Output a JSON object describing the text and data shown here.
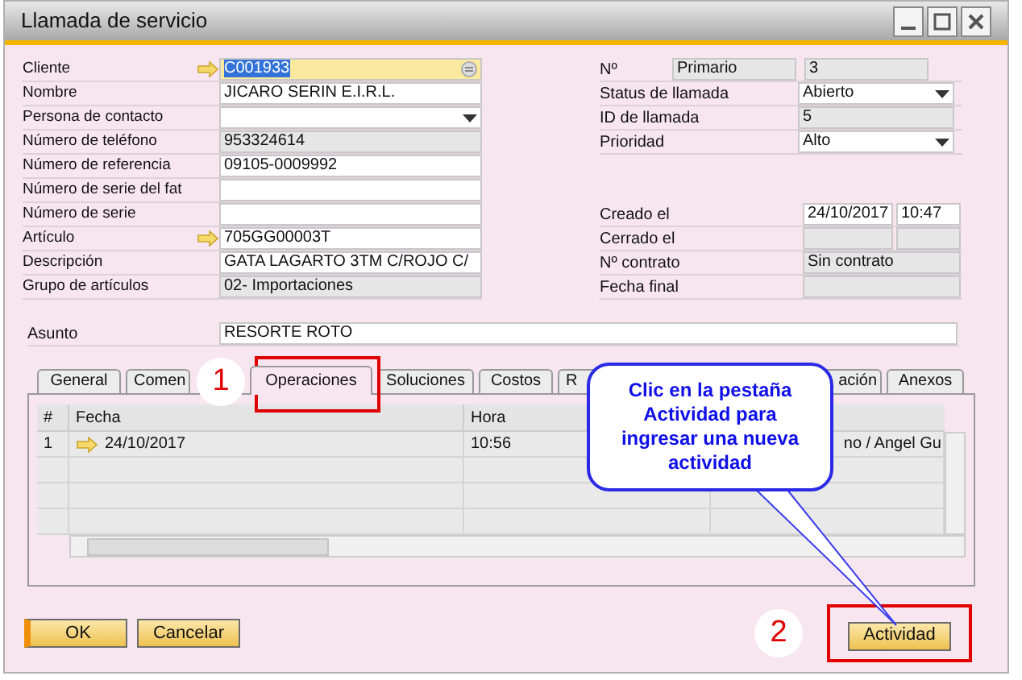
{
  "window": {
    "title": "Llamada de servicio"
  },
  "left_fields": [
    {
      "label": "Cliente",
      "kind": "lookup",
      "value": "C001933",
      "focused": true
    },
    {
      "label": "Nombre",
      "kind": "text",
      "value": "JICARO SERIN E.I.R.L.",
      "focused": false
    },
    {
      "label": "Persona de contacto",
      "kind": "dropdown",
      "focused": false
    },
    {
      "label": "Número de teléfono",
      "kind": "readonly",
      "value": "953324614",
      "focused": false
    },
    {
      "label": "Número de referencia",
      "kind": "text",
      "value": "09105-0009992",
      "focused": false
    },
    {
      "label": "Número de serie del fat",
      "kind": "text",
      "focused": false
    },
    {
      "label": "Número de serie",
      "kind": "text",
      "focused": false
    },
    {
      "label": "Artículo",
      "kind": "lookup",
      "value": "705GG00003T",
      "focused": false
    },
    {
      "label": "Descripción",
      "kind": "text",
      "value": "GATA LAGARTO 3TM C/ROJO  C/",
      "focused": false
    },
    {
      "label": "Grupo de artículos",
      "kind": "readonly",
      "value": "02- Importaciones",
      "focused": false
    }
  ],
  "right_fields_top": [
    {
      "label": "Nº",
      "fields": [
        {
          "kind": "readonly",
          "value": "Primario"
        },
        {
          "kind": "readonly",
          "value": "3"
        }
      ]
    },
    {
      "label": "Status de llamada",
      "fields": [
        {
          "kind": "dropdown",
          "value": "Abierto"
        }
      ]
    },
    {
      "label": "ID de llamada",
      "fields": [
        {
          "kind": "readonly",
          "value": "5"
        }
      ]
    },
    {
      "label": "Prioridad",
      "fields": [
        {
          "kind": "dropdown",
          "value": "Alto"
        }
      ]
    }
  ],
  "right_fields_bottom": [
    {
      "label": "Creado el",
      "fields": [
        {
          "kind": "text",
          "value": "24/10/2017"
        },
        {
          "kind": "text",
          "value": "10:47"
        }
      ]
    },
    {
      "label": "Cerrado el",
      "fields": [
        {
          "kind": "readonly"
        },
        {
          "kind": "readonly"
        }
      ]
    },
    {
      "label": "Nº contrato",
      "fields": [
        {
          "kind": "readonly",
          "value": "Sin contrato"
        }
      ]
    },
    {
      "label": "Fecha final",
      "fields": [
        {
          "kind": "readonly"
        }
      ]
    }
  ],
  "subject": {
    "label": "Asunto",
    "value": "RESORTE ROTO"
  },
  "tabs": [
    {
      "label": "General",
      "selected": false
    },
    {
      "label": "Comen",
      "selected": false
    },
    {
      "label": "Operaciones",
      "selected": true
    },
    {
      "label": "Soluciones",
      "selected": false
    },
    {
      "label": "Costos",
      "selected": false
    },
    {
      "label": "R",
      "selected": false
    },
    {
      "label": "ación",
      "selected": false
    },
    {
      "label": "Anexos",
      "selected": false
    }
  ],
  "table": {
    "columns": [
      "#",
      "Fecha",
      "Hora"
    ],
    "rows": [
      {
        "cells": [
          "1",
          "24/10/2017",
          "10:56",
          "no / Angel Gu"
        ]
      }
    ]
  },
  "buttons": [
    {
      "label": "OK",
      "kind": "default"
    },
    {
      "label": "Cancelar",
      "kind": "normal"
    },
    {
      "label": "Actividad",
      "kind": "normal"
    }
  ],
  "steps": [
    {
      "number": "1"
    },
    {
      "number": "2"
    }
  ],
  "callout": {
    "text": "Clic en la pestaña Actividad para ingresar una nueva actividad"
  }
}
